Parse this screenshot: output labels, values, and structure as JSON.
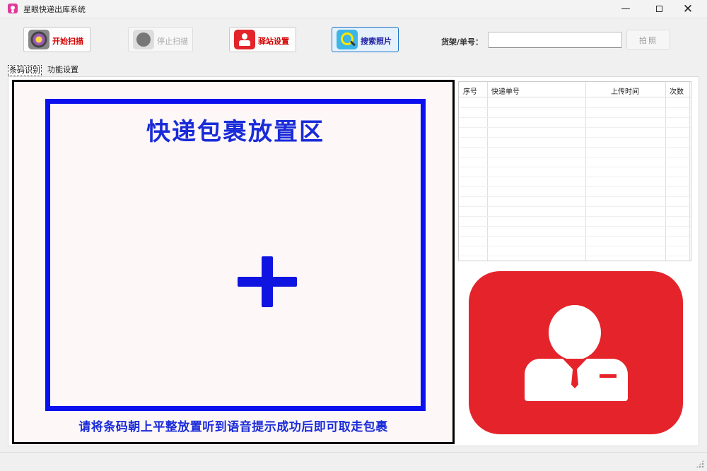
{
  "window": {
    "title": "星眼快递出库系统",
    "minimize_glyph": "—",
    "close_glyph": "✕"
  },
  "toolbar": {
    "start_scan": "开始扫描",
    "stop_scan": "停止扫描",
    "station_settings": "驿站设置",
    "search_photos": "搜索照片",
    "input_label": "货架/单号：",
    "input_value": "",
    "photo_button": "拍照"
  },
  "tabs": [
    {
      "label": "条码识别",
      "active": true
    },
    {
      "label": "功能设置",
      "active": false
    }
  ],
  "scan_area": {
    "title": "快递包裹放置区",
    "instruction": "请将条码朝上平整放置听到语音提示成功后即可取走包裹",
    "frame_color": "#0a10ee",
    "text_color": "#1a2bd8"
  },
  "grid": {
    "columns": [
      "序号",
      "快递单号",
      "上传时间",
      "次数"
    ],
    "rows": []
  },
  "avatar": {
    "icon": "courier-person-icon",
    "background_color": "#e4242a"
  }
}
